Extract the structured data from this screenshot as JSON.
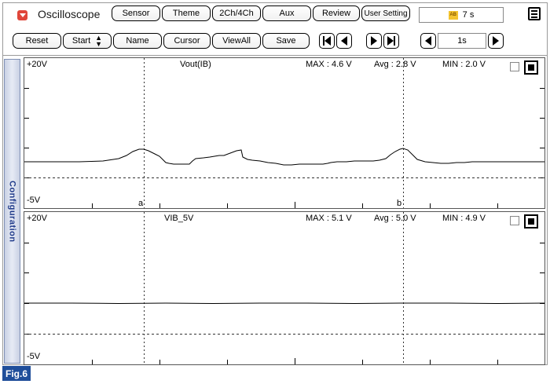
{
  "app": {
    "title": "Oscilloscope"
  },
  "top_tabs": [
    "Sensor",
    "Theme",
    "2Ch/4Ch",
    "Aux",
    "Review",
    "User Setting"
  ],
  "recording": {
    "label": "7 s",
    "icon": "ab-record-icon"
  },
  "toolbar": {
    "reset": "Reset",
    "start": "Start",
    "name": "Name",
    "cursor": "Cursor",
    "view_all": "ViewAll",
    "save": "Save",
    "time_scale": "1s"
  },
  "side_tab": {
    "label": "Configuration"
  },
  "channels": [
    {
      "name": "Vout(IB)",
      "max": "MAX : 4.6 V",
      "avg": "Avg : 2.8 V",
      "min": "MIN : 2.0 V",
      "y_top": "+20V",
      "y_bottom": "-5V",
      "cursor_a": "a",
      "cursor_b": "b"
    },
    {
      "name": "VIB_5V",
      "max": "MAX : 5.1 V",
      "avg": "Avg : 5.0 V",
      "min": "MIN : 4.9 V",
      "y_top": "+20V",
      "y_bottom": "-5V"
    }
  ],
  "figure_label": "Fig.6",
  "colors": {
    "trace": "#000000",
    "side_tab_text": "#1f3a8a",
    "fig_badge": "#1f4e9a",
    "app_icon": "#e0463a"
  }
}
